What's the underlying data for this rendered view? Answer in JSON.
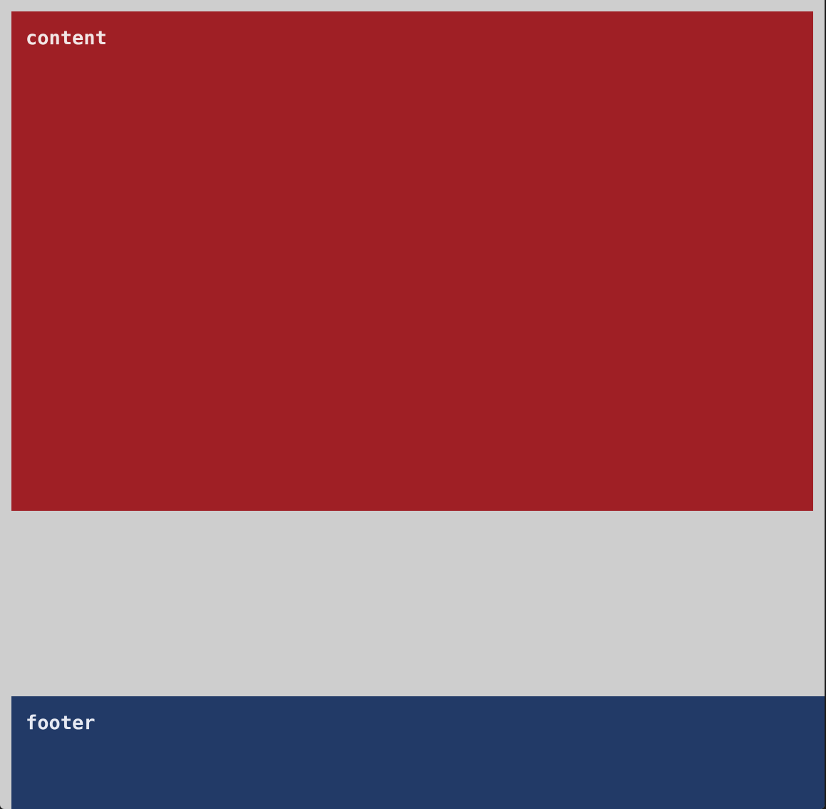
{
  "content": {
    "label": "content",
    "color": "#9f1f25"
  },
  "footer": {
    "label": "footer",
    "color": "#223a67"
  },
  "background": "#cecece"
}
